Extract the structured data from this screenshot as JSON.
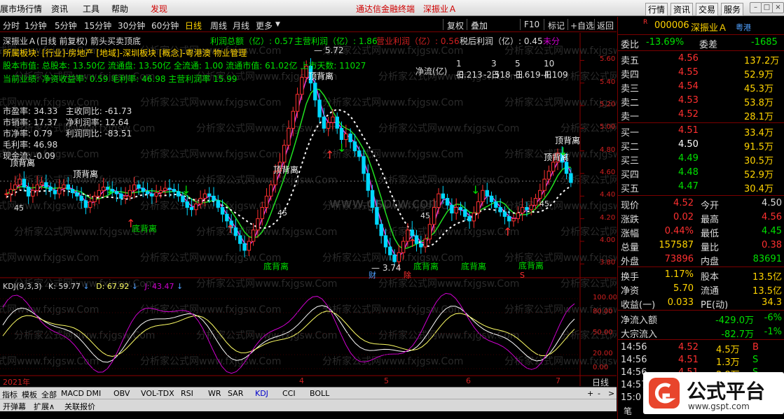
{
  "menubar": {
    "items": [
      "展市场行情",
      "资讯",
      "工具",
      "帮助",
      "发现"
    ],
    "center_title": "通达信金融终端",
    "center_stock": "深振业Ａ",
    "right_buttons": [
      "行情",
      "资讯",
      "交易",
      "服务"
    ]
  },
  "toolbar": {
    "periods": [
      "分时",
      "1分钟",
      "5分钟",
      "15分钟",
      "30分钟",
      "60分钟",
      "日线",
      "周线",
      "月线",
      "更多"
    ],
    "more_arrow": "▼",
    "actions": [
      "复权",
      "叠加",
      "F10",
      "标记",
      "+自选",
      "返回"
    ]
  },
  "info": {
    "line1": "深振业Ａ(日线 前复权) 箭头买卖顶底",
    "profit_total": "利润总额（亿）: 0.57",
    "main_profit": "主营利润（亿）: 1.86",
    "op_profit": "营业利润（亿）: 0.56",
    "net_profit": "税后利润（亿）: 0.45",
    "undistributed": "未分",
    "sector": "所属板块: [行业]-房地产 [地域]-深圳板块 [概念]-粤港澳 物业管理",
    "equity": "股本市值: 总股本: 13.50亿 流通盘: 13.50亿 全流通: 1.00 流通市值: 61.02亿 上市天数: 11027",
    "performance": "当前业绩: 净资收益率: 0.59 毛利率: 46.98 主营利润率 15.99",
    "fundamentals": [
      {
        "k": "市盈率",
        "v": "34.33",
        "k2": "主收同比",
        "v2": "-61.73"
      },
      {
        "k": "市销率",
        "v": "17.37",
        "k2": "净利润率",
        "v2": "12.64"
      },
      {
        "k": "市净率",
        "v": "0.79",
        "k2": "利润同比",
        "v2": "-83.51"
      },
      {
        "k": "毛利率",
        "v": "46.98",
        "k2": "",
        "v2": ""
      },
      {
        "k": "现金流",
        "v": "-0.09",
        "k2": "",
        "v2": ""
      }
    ],
    "netflow": {
      "label": "净流(亿)",
      "headers": [
        "1日",
        "3日",
        "5日",
        "10日"
      ],
      "values": [
        "-0.213",
        "-2.518",
        "-1.619",
        "-4.109"
      ]
    }
  },
  "annotations": {
    "high": "5.72",
    "low": "3.74",
    "top_label": "顶背离",
    "bottom_label": "底背离",
    "ma_tag": "45",
    "fin_marker": "财",
    "rights_marker": "除",
    "s_marker": "S",
    "watermark": "分析家公式网www.fxjgsw.Com",
    "watermark2": "www.gsptw.com"
  },
  "chart_data": {
    "type": "candlestick",
    "y_ticks": [
      "5.60",
      "5.40",
      "5.20",
      "5.00",
      "4.80",
      "4.60",
      "4.40",
      "4.20",
      "4.00",
      "3.80"
    ],
    "ylim": [
      3.74,
      5.72
    ],
    "kdj": {
      "label": "KDJ(9,3,3)",
      "k": "K: 59.77",
      "d": "D: 67.92",
      "j": "J: 43.47",
      "y_ticks": [
        "100.00",
        "80.00",
        "50.00",
        "20.00",
        "0.00"
      ]
    },
    "x_labels": [
      "2021年",
      "4",
      "5",
      "6",
      "7"
    ]
  },
  "bottom": {
    "tabs": [
      "指标",
      "模板",
      "全部",
      "MACD",
      "DMI",
      "OBV",
      "VOL-TDX",
      "RSI",
      "WR",
      "SAR",
      "KDJ",
      "CCI",
      "BOLL"
    ],
    "tabs2": [
      "开弹幕",
      "扩展∧",
      "关联报价"
    ],
    "period": "日线"
  },
  "quote": {
    "code": "000006",
    "name": "深振业Ａ",
    "region": "粤港",
    "r_tag": "R",
    "weibi_label": "委比",
    "weibi": "-13.69%",
    "weicha_label": "委差",
    "weicha": "-1685",
    "asks": [
      {
        "label": "卖五",
        "price": "4.56",
        "vol": "137.2万"
      },
      {
        "label": "卖四",
        "price": "4.55",
        "vol": "52.9万"
      },
      {
        "label": "卖三",
        "price": "4.54",
        "vol": "45.3万"
      },
      {
        "label": "卖二",
        "price": "4.53",
        "vol": "53.8万"
      },
      {
        "label": "卖一",
        "price": "4.52",
        "vol": "28.1万"
      }
    ],
    "bids": [
      {
        "label": "买一",
        "price": "4.51",
        "vol": "33.4万"
      },
      {
        "label": "买二",
        "price": "4.50",
        "vol": "91.5万"
      },
      {
        "label": "买三",
        "price": "4.49",
        "vol": "30.5万"
      },
      {
        "label": "买四",
        "price": "4.48",
        "vol": "52.9万"
      },
      {
        "label": "买五",
        "price": "4.47",
        "vol": "30.4万"
      }
    ],
    "stats": [
      {
        "k": "现价",
        "v": "4.52",
        "k2": "今开",
        "v2": "4.50"
      },
      {
        "k": "涨跌",
        "v": "0.02",
        "k2": "最高",
        "v2": "4.56"
      },
      {
        "k": "涨幅",
        "v": "0.44%",
        "k2": "最低",
        "v2": "4.45"
      },
      {
        "k": "总量",
        "v": "157587",
        "k2": "量比",
        "v2": "0.38"
      },
      {
        "k": "外盘",
        "v": "73896",
        "k2": "内盘",
        "v2": "83691"
      }
    ],
    "stats2": [
      {
        "k": "换手",
        "v": "1.17%",
        "k2": "股本",
        "v2": "13.5亿"
      },
      {
        "k": "净资",
        "v": "5.70",
        "k2": "流通",
        "v2": "13.5亿"
      },
      {
        "k": "收益(一)",
        "v": "0.033",
        "k2": "PE(动)",
        "v2": "34.3"
      }
    ],
    "flows": [
      {
        "k": "净流入额",
        "v": "-429.0万",
        "p": "-6%"
      },
      {
        "k": "大宗流入",
        "v": "-82.7万",
        "p": "-1%"
      }
    ],
    "ticks": [
      {
        "t": "14:56",
        "p": "4.52",
        "v": "4.5万",
        "s": "B"
      },
      {
        "t": "14:56",
        "p": "4.51",
        "v": "1.3万",
        "s": "S"
      },
      {
        "t": "14:56",
        "p": "4.51",
        "v": "2.8万",
        "s": "S"
      },
      {
        "t": "14:57",
        "p": "4.51",
        "v": "3.4万",
        "s": "S"
      },
      {
        "t": "15:0",
        "p": "",
        "v": "",
        "s": ""
      }
    ],
    "bottom_label": "笔"
  },
  "logo": {
    "text": "公式平台",
    "url": "www.gspt.com"
  }
}
